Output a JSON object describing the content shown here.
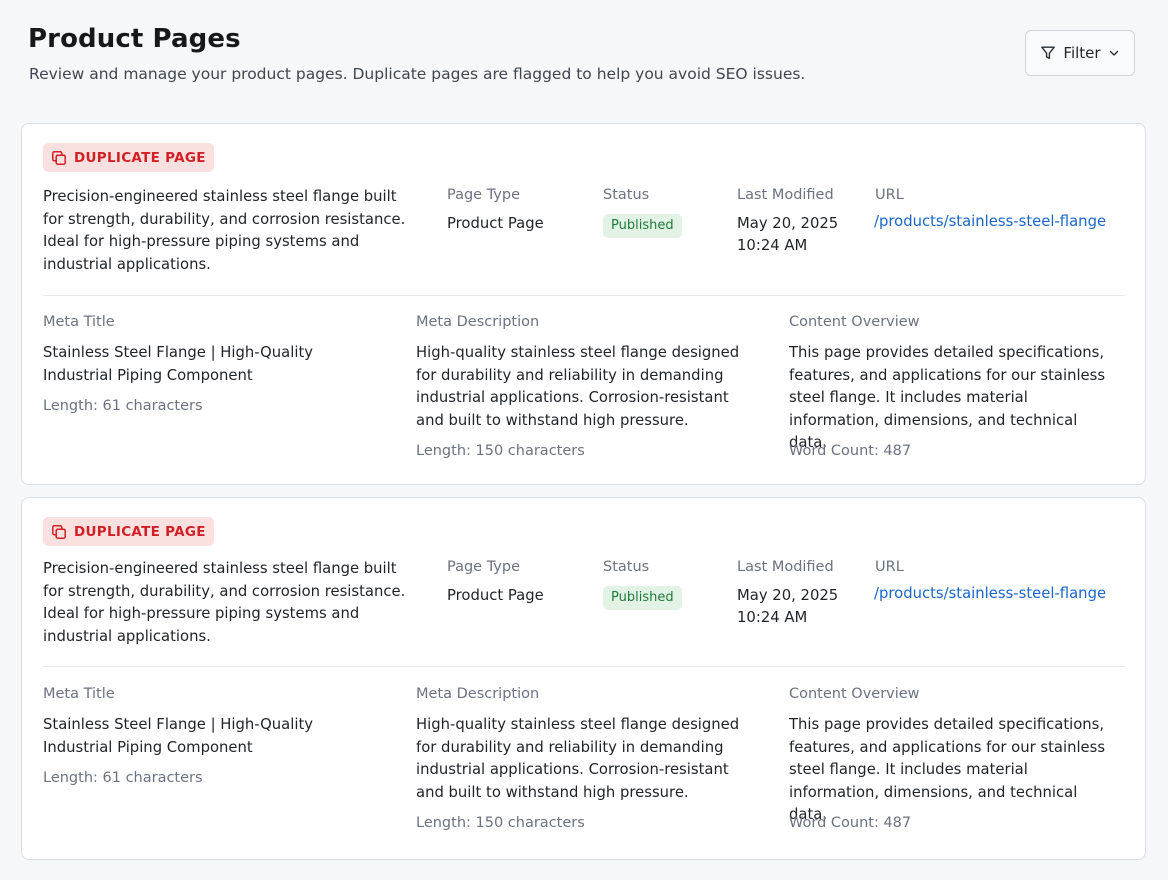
{
  "header": {
    "title": "Product Pages",
    "subtitle": "Review and manage your product pages. Duplicate pages are flagged to help you avoid SEO issues.",
    "filter_label": "Filter"
  },
  "labels": {
    "page_type": "Page Type",
    "status": "Status",
    "last_modified": "Last Modified",
    "url": "URL",
    "meta_title": "Meta Title",
    "meta_description": "Meta Description",
    "content_overview": "Content Overview"
  },
  "colors": {
    "duplicate_badge_bg": "#fbe0e0",
    "duplicate_badge_text": "#d11f26",
    "status_bg": "#e2f3e6",
    "status_text": "#1f7a39",
    "link": "#1a66c9"
  },
  "icons": {
    "filter": "filter-funnel-icon",
    "chevron": "chevron-down-icon",
    "duplicate": "copy-icon"
  },
  "cards": [
    {
      "badge": "DUPLICATE PAGE",
      "description": "Precision-engineered stainless steel flange built for strength, durability, and corrosion resistance. Ideal for high-pressure piping systems and industrial applications.",
      "page_type": "Product Page",
      "status": "Published",
      "last_modified_date": "May 20, 2025",
      "last_modified_time": "10:24 AM",
      "url": "/products/stainless-steel-flange",
      "meta_title": "Stainless Steel Flange | High-Quality Industrial Piping Component",
      "meta_title_length": "Length: 61 characters",
      "meta_description": "High-quality stainless steel flange designed for durability and reliability in demanding industrial applications. Corrosion-resistant and built to withstand high pressure.",
      "meta_description_length": "Length: 150 characters",
      "content_overview": "This page provides detailed specifications, features, and applications for our stainless steel flange. It includes material information, dimensions, and technical data.",
      "word_count": "Word Count: 487"
    },
    {
      "badge": "DUPLICATE PAGE",
      "description": "Precision-engineered stainless steel flange built for strength, durability, and corrosion resistance. Ideal for high-pressure piping systems and industrial applications.",
      "page_type": "Product Page",
      "status": "Published",
      "last_modified_date": "May 20, 2025",
      "last_modified_time": "10:24 AM",
      "url": "/products/stainless-steel-flange",
      "meta_title": "Stainless Steel Flange | High-Quality Industrial Piping Component",
      "meta_title_length": "Length: 61 characters",
      "meta_description": "High-quality stainless steel flange designed for durability and reliability in demanding industrial applications. Corrosion-resistant and built to withstand high pressure.",
      "meta_description_length": "Length: 150 characters",
      "content_overview": "This page provides detailed specifications, features, and applications for our stainless steel flange. It includes material information, dimensions, and technical data.",
      "word_count": "Word Count: 487"
    }
  ]
}
